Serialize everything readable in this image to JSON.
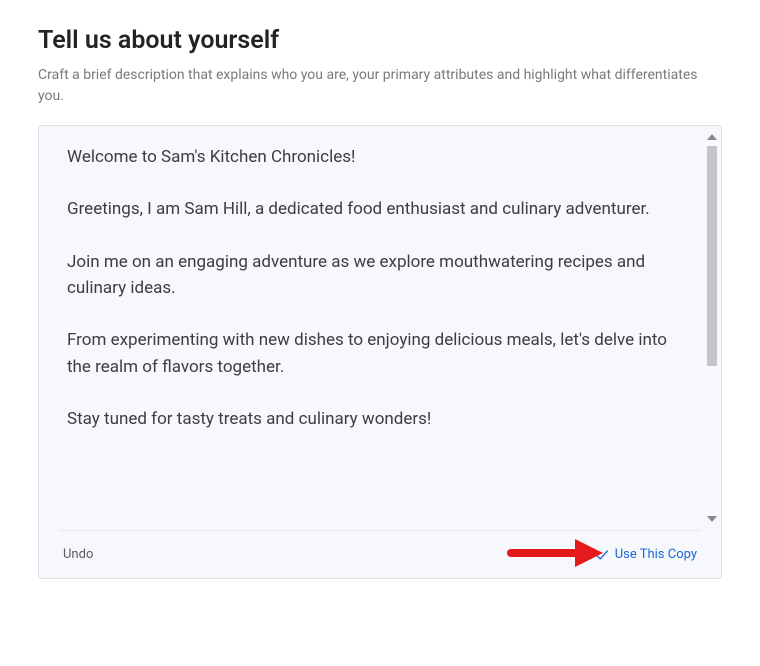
{
  "header": {
    "title": "Tell us about yourself",
    "subtitle": "Craft a brief description that explains who you are, your primary attributes and highlight what differentiates you."
  },
  "description": {
    "p1": "Welcome to Sam's Kitchen Chronicles!",
    "p2": "Greetings, I am Sam Hill, a dedicated food enthusiast and culinary adventurer.",
    "p3": "Join me on an engaging adventure as we explore mouthwatering recipes and culinary ideas.",
    "p4": "From experimenting with new dishes to enjoying delicious meals, let's delve into the realm of flavors together.",
    "p5": "Stay tuned for tasty treats and culinary wonders!"
  },
  "footer": {
    "undo_label": "Undo",
    "use_copy_label": "Use This Copy"
  },
  "colors": {
    "link": "#1a66d1",
    "arrow": "#e31b1b"
  }
}
